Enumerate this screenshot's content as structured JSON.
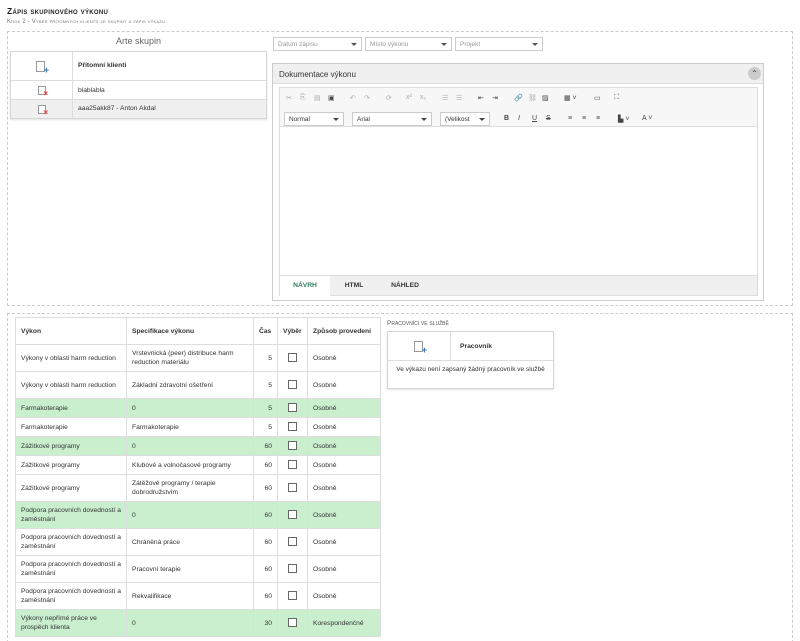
{
  "header": {
    "title": "Zápis skupinového výkonu",
    "subtitle": "Krok 2 - Výběr přítomných klientů ze skupiny a zápis výkazu"
  },
  "group": {
    "name": "Arte skupin",
    "column_header": "Přítomní klienti",
    "clients": [
      "blablabla",
      "aaa25akk87 - Anton Akdal"
    ]
  },
  "filters": {
    "date": "Datum zápisu",
    "place": "Místo výkonu",
    "project": "Projekt"
  },
  "documentation": {
    "title": "Dokumentace výkonu",
    "format": "Normal",
    "font": "Arial",
    "size": "(Velikost",
    "tabs": [
      "NÁVRH",
      "HTML",
      "NÁHLED"
    ],
    "active_tab": "NÁVRH"
  },
  "vykony": {
    "headers": [
      "Výkon",
      "Specifikace výkonu",
      "Čas",
      "Výběr",
      "Způsob provedení"
    ],
    "rows": [
      {
        "vykon": "Výkony v oblasti harm reduction",
        "spec": "Vrstevnická (peer) distribuce harm reduction materiálu",
        "cas": "5",
        "zpusob": "Osobně",
        "green": false
      },
      {
        "vykon": "Výkony v oblasti harm reduction",
        "spec": "Základní zdravotní ošetření",
        "cas": "5",
        "zpusob": "Osobně",
        "green": false
      },
      {
        "vykon": "Farmakoterapie",
        "spec": "0",
        "cas": "5",
        "zpusob": "Osobně",
        "green": true
      },
      {
        "vykon": "Farmakoterapie",
        "spec": "Farmakoterapie",
        "cas": "5",
        "zpusob": "Osobně",
        "green": false
      },
      {
        "vykon": "Zážitkové programy",
        "spec": "0",
        "cas": "60",
        "zpusob": "Osobně",
        "green": true
      },
      {
        "vykon": "Zážitkové programy",
        "spec": "Klubové a volnočasové programy",
        "cas": "60",
        "zpusob": "Osobně",
        "green": false
      },
      {
        "vykon": "Zážitkové programy",
        "spec": "Zátěžové programy / terapie dobrodružstvím",
        "cas": "60",
        "zpusob": "Osobně",
        "green": false
      },
      {
        "vykon": "Podpora pracovních dovedností a zaměstnání",
        "spec": "0",
        "cas": "60",
        "zpusob": "Osobně",
        "green": true
      },
      {
        "vykon": "Podpora pracovních dovedností a zaměstnání",
        "spec": "Chráněná práce",
        "cas": "60",
        "zpusob": "Osobně",
        "green": false
      },
      {
        "vykon": "Podpora pracovních dovedností a zaměstnání",
        "spec": "Pracovní terapie",
        "cas": "60",
        "zpusob": "Osobně",
        "green": false
      },
      {
        "vykon": "Podpora pracovních dovedností a zaměstnání",
        "spec": "Rekvalifikace",
        "cas": "60",
        "zpusob": "Osobně",
        "green": false
      },
      {
        "vykon": "Výkony nepřímé práce ve prospěch klienta",
        "spec": "0",
        "cas": "30",
        "zpusob": "Korespondenčně",
        "green": true
      }
    ]
  },
  "workers": {
    "section_title": "Pracovníci ve službě",
    "column_header": "Pracovník",
    "empty_text": "Ve výkazu není zapsaný žádný pracovník ve službě"
  }
}
